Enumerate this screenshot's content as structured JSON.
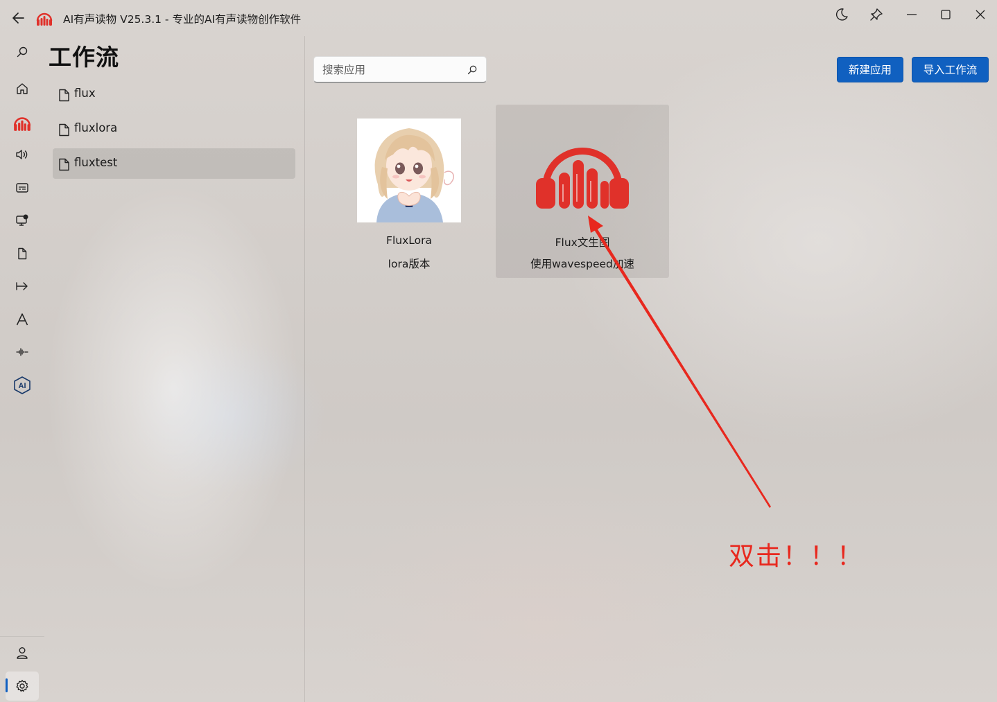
{
  "window": {
    "title": "AI有声读物 V25.3.1 - 专业的AI有声读物创作软件"
  },
  "nav_rail": {
    "top_items": [
      {
        "icon": "search-icon"
      },
      {
        "icon": "home-icon"
      },
      {
        "icon": "headphones-logo-icon"
      },
      {
        "icon": "speaker-icon"
      },
      {
        "icon": "subtitle-icon"
      },
      {
        "icon": "monitor-settings-icon"
      },
      {
        "icon": "document-icon"
      },
      {
        "icon": "arrow-to-line-icon"
      },
      {
        "icon": "font-icon"
      },
      {
        "icon": "waveform-icon"
      },
      {
        "icon": "ai-badge-icon",
        "label": "AI"
      }
    ],
    "bottom_items": [
      {
        "icon": "user-icon"
      },
      {
        "icon": "gear-icon",
        "selected": true
      }
    ]
  },
  "panel": {
    "title": "工作流",
    "workflows": [
      {
        "name": "flux",
        "selected": false
      },
      {
        "name": "fluxlora",
        "selected": false
      },
      {
        "name": "fluxtest",
        "selected": true
      }
    ]
  },
  "search": {
    "placeholder": "搜索应用",
    "value": ""
  },
  "actions": {
    "new_app": "新建应用",
    "import_workflow": "导入工作流"
  },
  "apps": [
    {
      "name": "FluxLora",
      "description": "lora版本",
      "thumbnail": "anime-girl-image"
    },
    {
      "name": "Flux文生图",
      "description": "使用wavespeed加速",
      "thumbnail": "headphones-logo-icon"
    }
  ],
  "annotation": {
    "text": "双击！！！",
    "color": "#e8281e"
  },
  "colors": {
    "accent": "#1060c0",
    "brand_red": "#e0312a"
  }
}
